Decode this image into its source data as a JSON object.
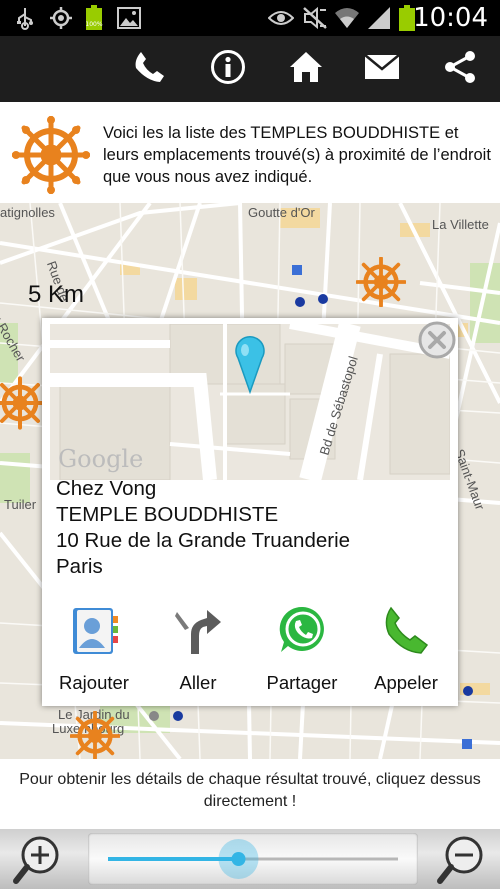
{
  "status_bar": {
    "time": "10:04",
    "battery_left_label": "100%",
    "icons": [
      "usb-icon",
      "gps-icon",
      "battery-icon",
      "image-icon",
      "eye-icon",
      "mute-icon",
      "wifi-icon",
      "signal-icon",
      "battery-icon"
    ]
  },
  "action_bar": {
    "buttons": [
      "phone-icon",
      "info-icon",
      "home-icon",
      "mail-icon",
      "share-icon"
    ]
  },
  "header": {
    "description": "Voici les la liste des TEMPLES BOUDDHISTE et leurs emplacements trouvé(s) à proximité de l’endroit que vous nous avez indiqué."
  },
  "map": {
    "distance_label": "5 Km",
    "street_labels": {
      "batignolles": "atignolles",
      "goutte_dor": "Goutte d'Or",
      "la_villette": "La Villette",
      "rue_de": "Rue de",
      "rochers": "u Rocher",
      "tuiler": "Tuiler",
      "saint_maur": "Saint-Maur",
      "jardin": "Le Jardin du",
      "luxembourg": "Luxembourg"
    }
  },
  "popup": {
    "mini_map": {
      "street_label": "Bd de Sébastopol",
      "watermark": "Google"
    },
    "name": "Chez Vong",
    "category": "TEMPLE BOUDDHISTE",
    "street": "10 Rue de la Grande Truanderie",
    "city": "Paris",
    "actions": [
      {
        "label": "Rajouter",
        "icon": "contact-card-icon"
      },
      {
        "label": "Aller",
        "icon": "turn-arrow-icon"
      },
      {
        "label": "Partager",
        "icon": "whatsapp-icon"
      },
      {
        "label": "Appeler",
        "icon": "phone-call-icon"
      }
    ]
  },
  "hint": {
    "text": "Pour obtenir les détails de chaque résultat trouvé, cliquez dessus directement !"
  },
  "zoom": {
    "level": 0.45,
    "zoom_in_icon": "zoom-in-icon",
    "zoom_out_icon": "zoom-out-icon"
  },
  "colors": {
    "wheel_orange": "#e8821e",
    "pin_cyan": "#3bc1e6",
    "action_bar": "#1e1e1e",
    "slider_blue": "#33b5e5"
  }
}
